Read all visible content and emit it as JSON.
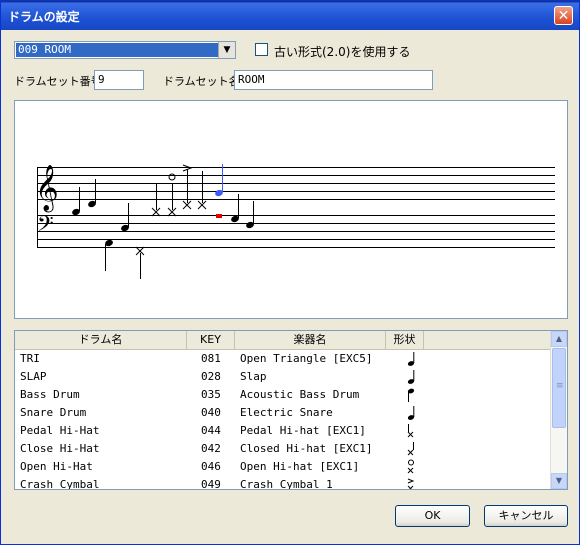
{
  "window": {
    "title": "ドラムの設定",
    "close_glyph": "✕"
  },
  "top": {
    "combo_value": "009 ROOM",
    "combo_arrow": "▼",
    "checkbox_label": "古い形式(2.0)を使用する",
    "drumset_number_label": "ドラムセット番号",
    "drumset_number_value": "9",
    "drumset_name_label": "ドラムセット名",
    "drumset_name_value": "ROOM"
  },
  "notation": {
    "treble_clef": "𝄞",
    "bass_clef": "𝄢",
    "highlight_colors": {
      "selected": "#3b5bff",
      "marker": "#e00000"
    }
  },
  "list": {
    "columns": [
      "ドラム名",
      "KEY",
      "楽器名",
      "形状"
    ],
    "rows": [
      {
        "drum": "TRI",
        "key": "081",
        "inst": "Open Triangle [EXC5]",
        "shape": "quarter"
      },
      {
        "drum": "SLAP",
        "key": "028",
        "inst": "Slap",
        "shape": "quarter"
      },
      {
        "drum": "Bass Drum",
        "key": "035",
        "inst": "Acoustic Bass Drum",
        "shape": "stem-flag"
      },
      {
        "drum": "Snare Drum",
        "key": "040",
        "inst": "Electric Snare",
        "shape": "quarter"
      },
      {
        "drum": "Pedal Hi-Hat",
        "key": "044",
        "inst": "Pedal Hi-hat [EXC1]",
        "shape": "x-head"
      },
      {
        "drum": "Close Hi-Hat",
        "key": "042",
        "inst": "Closed Hi-hat [EXC1]",
        "shape": "x-open"
      },
      {
        "drum": "Open Hi-Hat",
        "key": "046",
        "inst": "Open Hi-hat [EXC1]",
        "shape": "x-circle"
      },
      {
        "drum": "Crash Cymbal",
        "key": "049",
        "inst": "Crash Cymbal 1",
        "shape": "x-accent"
      }
    ],
    "scroll_up": "▲",
    "scroll_down": "▼",
    "scroll_grip": "≡"
  },
  "buttons": {
    "ok": "OK",
    "cancel": "キャンセル"
  }
}
